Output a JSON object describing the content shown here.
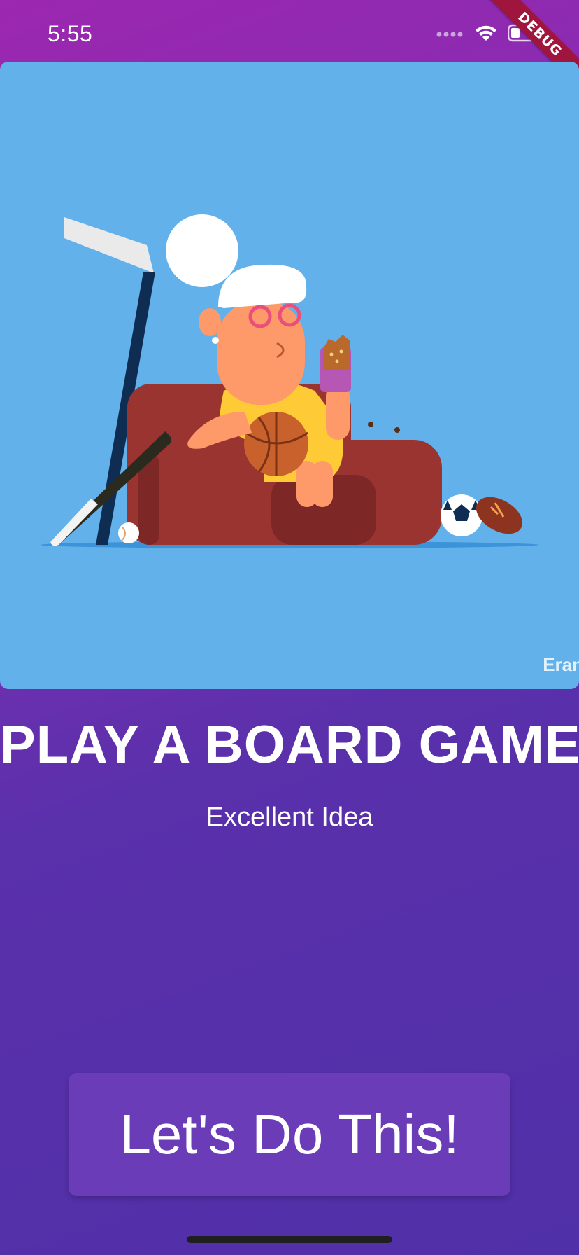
{
  "status_bar": {
    "time": "5:55",
    "debug_label": "DEBUG",
    "icons": [
      "signal-dots-icon",
      "wifi-icon",
      "battery-icon"
    ]
  },
  "hero": {
    "image_name": "grandma-on-sofa-illustration",
    "credit": "Eran"
  },
  "activity": {
    "title": "PLAY A BOARD GAME",
    "subtitle": "Excellent Idea"
  },
  "action": {
    "label": "Let's Do This!"
  },
  "colors": {
    "background_top": "#9c27b0",
    "background_bottom": "#5030a8",
    "hero_sky": "#62b1ea",
    "button": "#6a3cb8",
    "text": "#ffffff",
    "debug_ribbon": "#a0153e"
  }
}
